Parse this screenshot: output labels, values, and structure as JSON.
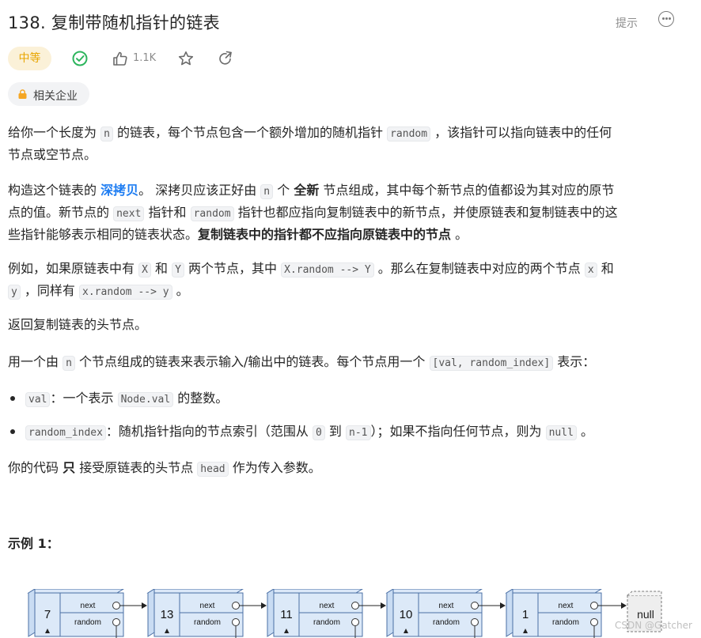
{
  "header": {
    "title": "138. 复制带随机指针的链表",
    "hint": "提示"
  },
  "meta": {
    "difficulty": "中等",
    "likes": "1.1K",
    "tag": "相关企业",
    "colors": {
      "difficulty_text": "#e8a500",
      "solved_check": "#2db55d"
    }
  },
  "p1": {
    "t1": "给你一个长度为 ",
    "c1": "n",
    "t2": " 的链表，每个节点包含一个额外增加的随机指针 ",
    "c2": "random",
    "t3": " ，该指针可以指向链表中的任何",
    "t4": "节点或空节点。"
  },
  "p2": {
    "t1": "构造这个链表的 ",
    "link": "深拷贝",
    "t2": "。 深拷贝应该正好由 ",
    "c1": "n",
    "t3": " 个 ",
    "b1": "全新",
    "t4": " 节点组成，其中每个新节点的值都设为其对应的原节",
    "t5": "点的值。新节点的 ",
    "c2": "next",
    "t6": " 指针和 ",
    "c3": "random",
    "t7": " 指针也都应指向复制链表中的新节点，并使原链表和复制链表中的这",
    "t8": "些指针能够表示相同的链表状态。",
    "b2": "复制链表中的指针都不应指向原链表中的节点",
    "t9": " 。"
  },
  "p3": {
    "t1": "例如，如果原链表中有 ",
    "c1": "X",
    "t2": " 和 ",
    "c2": "Y",
    "t3": " 两个节点，其中 ",
    "c3": "X.random --> Y",
    "t4": " 。那么在复制链表中对应的两个节点 ",
    "c4": "x",
    "t5": " 和",
    "c5": "y",
    "t6": " ，同样有 ",
    "c6": "x.random --> y",
    "t7": " 。"
  },
  "p4": {
    "t1": "返回复制链表的头节点。"
  },
  "p5": {
    "t1": "用一个由 ",
    "c1": "n",
    "t2": " 个节点组成的链表来表示输入/输出中的链表。每个节点用一个 ",
    "c2": "[val, random_index]",
    "t3": " 表示："
  },
  "bullets": [
    {
      "c1": "val",
      "t1": "：一个表示 ",
      "c2": "Node.val",
      "t2": " 的整数。"
    },
    {
      "c1": "random_index",
      "t1": "：随机指针指向的节点索引（范围从 ",
      "c2": "0",
      "t2": " 到 ",
      "c3": "n-1",
      "t3": "）；如果不指向任何节点，则为 ",
      "c4": "null",
      "t4": " 。"
    }
  ],
  "p6": {
    "t1": "你的代码 ",
    "b1": "只",
    "t2": " 接受原链表的头节点 ",
    "c1": "head",
    "t3": " 作为传入参数。"
  },
  "example": {
    "title": "示例 1：",
    "nodes": [
      "7",
      "13",
      "11",
      "10",
      "1"
    ],
    "next_label": "next",
    "random_label": "random",
    "null_label": "null"
  },
  "watermark": "CSDN @Gatcher"
}
